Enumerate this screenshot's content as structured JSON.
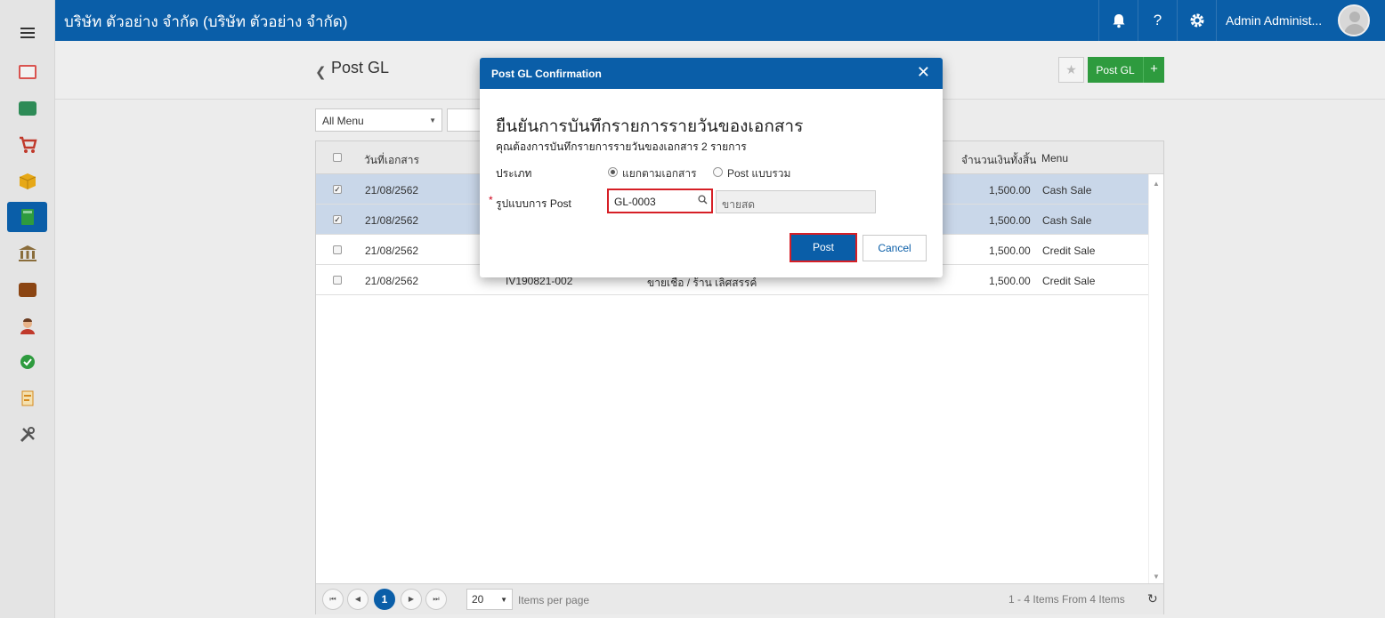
{
  "header": {
    "company": "บริษัท ตัวอย่าง จำกัด (บริษัท ตัวอย่าง จำกัด)",
    "user_name": "Admin Administ...",
    "icons": [
      "bell-icon",
      "help-icon",
      "settings-icon"
    ],
    "help_glyph": "?"
  },
  "sidebar": {
    "items": [
      {
        "name": "dashboard",
        "color": "#d9534f"
      },
      {
        "name": "cash",
        "color": "#2e8b57"
      },
      {
        "name": "sales-cart",
        "color": "#c0392b"
      },
      {
        "name": "inventory-box",
        "color": "#e6a817"
      },
      {
        "name": "accounting-book",
        "color": "#2e9b3e",
        "active": true
      },
      {
        "name": "bank",
        "color": "#8a6d3b"
      },
      {
        "name": "wallet",
        "color": "#8b4513"
      },
      {
        "name": "hr-person",
        "color": "#c0392b"
      },
      {
        "name": "approve-check",
        "color": "#2e9b3e"
      },
      {
        "name": "report",
        "color": "#d68a1e"
      },
      {
        "name": "tools",
        "color": "#555555"
      }
    ]
  },
  "page": {
    "title": "Post GL",
    "post_gl_label": "Post GL",
    "plus": "+"
  },
  "filter": {
    "menu_value": "All Menu"
  },
  "grid": {
    "columns": {
      "date": "วันที่เอกสาร",
      "amount": "จำนวนเงินทั้งสิ้น",
      "menu": "Menu"
    },
    "rows": [
      {
        "checked": true,
        "date": "21/08/2562",
        "doc": "",
        "desc": "",
        "amount": "1,500.00",
        "menu": "Cash Sale"
      },
      {
        "checked": true,
        "date": "21/08/2562",
        "doc": "",
        "desc": "",
        "amount": "1,500.00",
        "menu": "Cash Sale"
      },
      {
        "checked": false,
        "date": "21/08/2562",
        "doc": "",
        "desc": "",
        "amount": "1,500.00",
        "menu": "Credit Sale"
      },
      {
        "checked": false,
        "date": "21/08/2562",
        "doc": "IV190821-002",
        "desc": "ขายเชื่อ / ร้าน เลิศสรรค์",
        "amount": "1,500.00",
        "menu": "Credit Sale"
      }
    ]
  },
  "pager": {
    "current_page": "1",
    "page_size": "20",
    "items_per_page": "Items per page",
    "info": "1 - 4 Items From 4 Items"
  },
  "modal": {
    "title": "Post GL Confirmation",
    "heading": "ยืนยันการบันทึกรายการรายวันของเอกสาร",
    "subheading": "คุณต้องการบันทึกรายการรายวันของเอกสาร 2 รายการ",
    "type_label": "ประเภท",
    "option_separate": "แยกตามเอกสาร",
    "option_combined": "Post แบบรวม",
    "selected_option": "separate",
    "format_label": "รูปแบบการ Post",
    "format_code": "GL-0003",
    "format_name": "ขายสด",
    "post_button": "Post",
    "cancel_button": "Cancel"
  }
}
